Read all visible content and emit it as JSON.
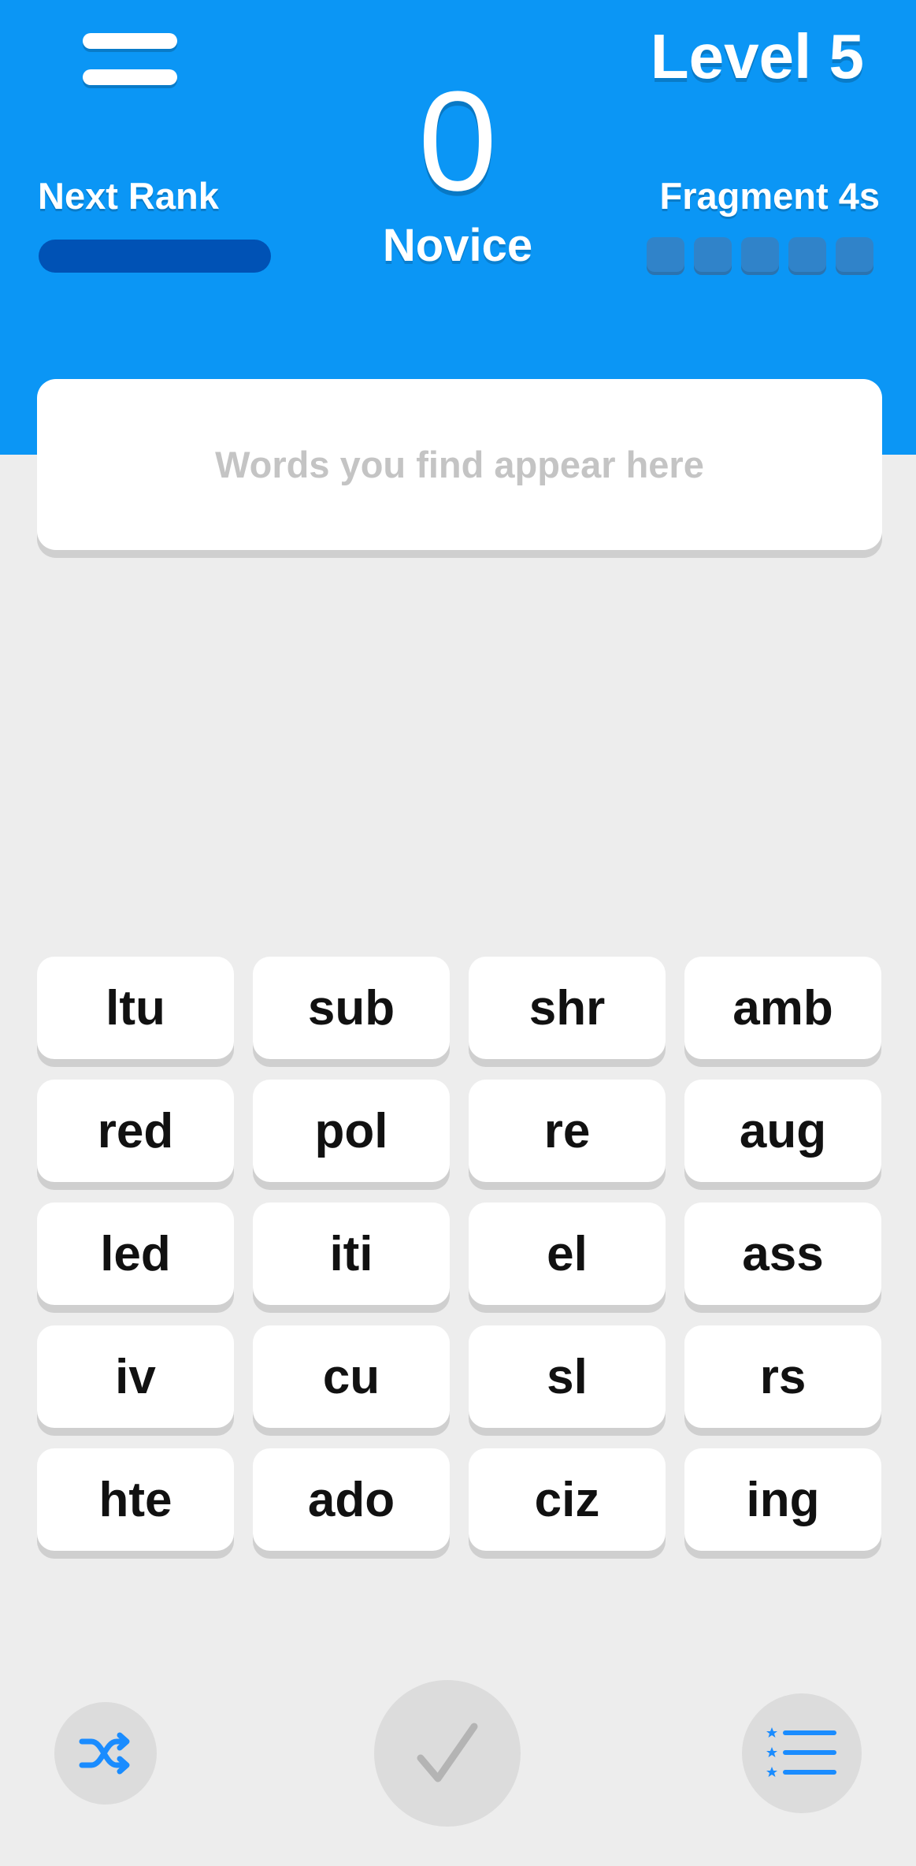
{
  "header": {
    "level_label": "Level 5",
    "score": "0",
    "rank_name": "Novice",
    "next_rank": {
      "label": "Next Rank",
      "progress_fraction": 0
    },
    "fragment": {
      "label": "Fragment 4s",
      "slots_filled": 0,
      "slots_total": 5
    },
    "background_color": "#0b96f5",
    "menu_icon": "hamburger-menu-icon"
  },
  "found_words": {
    "placeholder": "Words you find appear here",
    "words": []
  },
  "tiles": [
    [
      "ltu",
      "sub",
      "shr",
      "amb"
    ],
    [
      "red",
      "pol",
      "re",
      "aug"
    ],
    [
      "led",
      "iti",
      "el",
      "ass"
    ],
    [
      "iv",
      "cu",
      "sl",
      "rs"
    ],
    [
      "hte",
      "ado",
      "ciz",
      "ing"
    ]
  ],
  "controls": {
    "shuffle_icon": "shuffle-icon",
    "submit_icon": "checkmark-icon",
    "list_icon": "ranked-list-icon",
    "accent_color": "#1a8cff"
  }
}
